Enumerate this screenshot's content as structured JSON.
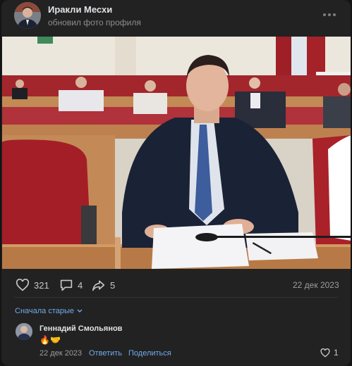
{
  "post": {
    "author": "Иракли Месхи",
    "action": "обновил фото профиля",
    "date": "22 дек 2023",
    "likes": "321",
    "comments": "4",
    "shares": "5"
  },
  "comments_section": {
    "sort_label": "Сначала старые",
    "items": [
      {
        "author": "Геннадий Смольянов",
        "text": "🔥🤝",
        "date": "22 дек 2023",
        "reply_label": "Ответить",
        "share_label": "Поделиться",
        "likes": "1"
      }
    ]
  },
  "icons": {
    "more": "more-icon",
    "like": "heart-icon",
    "comment": "comment-icon",
    "share": "share-arrow-icon",
    "sort": "chevron-down-icon"
  },
  "colors": {
    "background": "#141414",
    "card": "#222222",
    "link": "#71aaeb",
    "muted": "#8a8d91"
  }
}
